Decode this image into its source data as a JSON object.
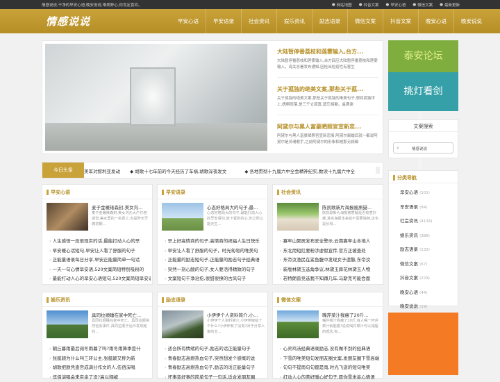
{
  "topbar": {
    "tagline": "情感说说,干净的早安心语,晚安说说,唯美舒心,你肯定喜欢。",
    "links": [
      "网站地图",
      "抖音文案",
      "早安心语",
      "微信文案",
      "最新更新"
    ]
  },
  "header": {
    "logo": "情感说说",
    "nav": [
      "早安心语",
      "早安语录",
      "社会资讯",
      "娱乐资讯",
      "励志语录",
      "微信文案",
      "抖音文案",
      "晚安心语",
      "晚安说说"
    ]
  },
  "hero": {
    "items": [
      {
        "title": "大陆暂停番荔枝和莲雾输入,台方...",
        "desc": "大陆暂停番荔枝和莲雾输入,台方回应大陆暂停番荔枝和莲雾输入，海关总署发布通知,因检出检疫性有害生"
      },
      {
        "title": "关于孤独的绝美文案,那些关于孤...",
        "desc": "关于孤独的绝美文案,那些关于孤独的唯美句子,想到孤独世上,梧桐雨落,是三千丈孤寞,遗忘相聚。遥满谢"
      },
      {
        "title": "阿黛尔与黑人富豪晒照官宣新恋...",
        "desc": "阿黛尔与黑人富豪晒照官宣新恋情,阿黛尔离婚后就一都说阿黛尔是灵魂歌手,之前阿黛尔的形象和她那无颖都"
      }
    ]
  },
  "ticker": {
    "label": "今日头条",
    "items": [
      "美军对叙利亚发动",
      "胡歌十七年前的今天经历了车祸,胡歌深夜发文",
      "各地贯彻十九届六中全会精神纪实,数读十九届六中全"
    ]
  },
  "sections": [
    {
      "title": "早安心语",
      "featured_title": "麦子金暖裱森封,美女沟...",
      "featured_desc": "麦子金暖裱森封,美女沟元大户灯塔感觉,美女里的一名贵工,也是昨天牙痛初期...",
      "items": [
        "人生感悟一段很现实的话,最能打动人心的早",
        "早安暖心话短句,早安让人看了舒服的句子",
        "正能量语录每日分享,早安正能量简单一句话",
        "一天一句心情早安语,520文案简短特别吸粉的",
        "最能打动人心的早安心语短句,520文案简短早安语"
      ]
    },
    {
      "title": "早安语录",
      "featured_title": "心态好格局大的句子,最...",
      "featured_desc": "心态好格局大的句子,最能打动人心的早安语句,放下紧张的心,你之所以能天生...",
      "items": [
        "早上好高情商的句子,高情商的祝福人生日快乐",
        "早安让人看了舒服的句子，时光匆匆的唯美句",
        "正能量的励志短句子,正能量的励志句子经典语",
        "突然一刻心酸的句子,女人要活得精致的句子",
        "文案短句干净治愈,很甜很撩的古风句子"
      ]
    },
    {
      "title": "社会资讯",
      "featured_title": "陈凯歌新片海报被质疑...",
      "featured_desc": "陈凯歌新片海报被质疑是否有意抄袭,其实海报本来就不需要独特,这也是长得...",
      "items": [
        "寡牢山聚居发布安全警示,云南寡牢山本地人",
        "东北用短红要粉涉虚假宣传,官方正被查处",
        "东帝汶渔民在鲨鱼腹中发现女子遗骸,东帝汶",
        "新版林黛玉选角争议,林黛玉葬花林黛玉人物",
        "若特朗普竞选我不知蹲几年,马斯克可能会面"
      ]
    },
    {
      "title": "娱乐资讯",
      "featured_title": "具同拉顺睡在家中死亡...",
      "featured_desc": "具同拉顺睡在家中死亡，具同拉顺突然恰去事件,具同拉顺于近日发现她的...",
      "items": [
        "朝丘暮雨最后阅冬雨暮了吗?雨冬雨算季是什",
        "张艇颖为什么叫三环公主,张艇颖又称为新",
        "胡歌把朕凭查宫成满分作文的人,伍佰演唱",
        "伍佰演唱会来实亲了没?高以翔被"
      ]
    },
    {
      "title": "励志语录",
      "featured_title": "小伊伊个人资料简介,小...",
      "featured_desc": "小伊伊个人资料简介,小伊伊嫁给了个什么?小伊伊有了没有?对于分享人家的主...",
      "items": [
        "适合所有情绪的句子,励志的话正能量句子",
        "青春励志高燃热血句子,突然想发个感慨的说",
        "青春励志高燃热血句子,励志的话正能量句子",
        "坏事变好事的简单句子一句话,适合发朋友圈"
      ]
    },
    {
      "title": "微信文案",
      "featured_title": "嘴芹菜汁我瘦了20斤...",
      "featured_desc": "嘴芹菜汁我瘦了20斤,有人喝一杯芹菜汁就能瘦?说说喝芹菜汁可以减脂的观念,有...",
      "items": [
        "心灵鸡汤经典语录励志,没有做不到的经典语",
        "下雪的唯美短句发朋友圈文案,发朋友圈下雪高端",
        "句句不提雨句句都是雨,时光飞逝的短句唯美",
        "打动人心的美好暖心好句子,愿你雪米娑心情语"
      ]
    }
  ],
  "sidebar": {
    "ad_text_1": "泰安论坛",
    "ad_text_2": "挑灯看剑",
    "search_title": "文案搜索",
    "search_value": "情感说说",
    "cats_title": "分类导航",
    "categories": [
      {
        "name": "早安心语",
        "count": "(101)"
      },
      {
        "name": "早安语录",
        "count": "(84)"
      },
      {
        "name": "社会资讯",
        "count": "(4134)"
      },
      {
        "name": "娱乐资讯",
        "count": "(386)"
      },
      {
        "name": "励志语录",
        "count": "(132)"
      },
      {
        "name": "微信文案",
        "count": "(67)"
      },
      {
        "name": "抖音文案",
        "count": "(229)"
      },
      {
        "name": "晚安心语",
        "count": "(44)"
      },
      {
        "name": "晚安说说",
        "count": "(19)"
      }
    ]
  }
}
